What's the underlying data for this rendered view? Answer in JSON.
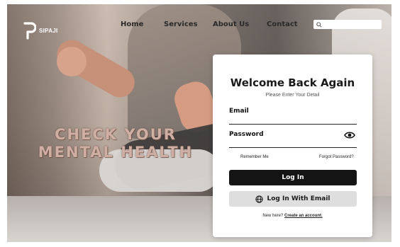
{
  "brand": {
    "name": "SIPAJI"
  },
  "nav": {
    "home": "Home",
    "services": "Services",
    "about": "About Us",
    "contact": "Contact"
  },
  "search": {
    "placeholder": "",
    "icon": "search-icon"
  },
  "hero": {
    "line1": "CHECK YOUR",
    "line2": "MENTAL HEALTH"
  },
  "login": {
    "title": "Welcome Back Again",
    "subtitle": "Please Enter Your Detail",
    "email_label": "Email",
    "email_value": "",
    "password_label": "Password",
    "password_value": "",
    "eye_icon": "eye-icon",
    "remember": "Remember Me",
    "forgot": "Forgot Password?",
    "login_button": "Log In",
    "email_button": "Log In With Email",
    "email_button_icon": "globe-icon",
    "new_here": "New here?",
    "create_account": "Create an account."
  },
  "colors": {
    "primary": "#141414",
    "secondary_button": "#dedede",
    "headline": "#cfaea4"
  }
}
